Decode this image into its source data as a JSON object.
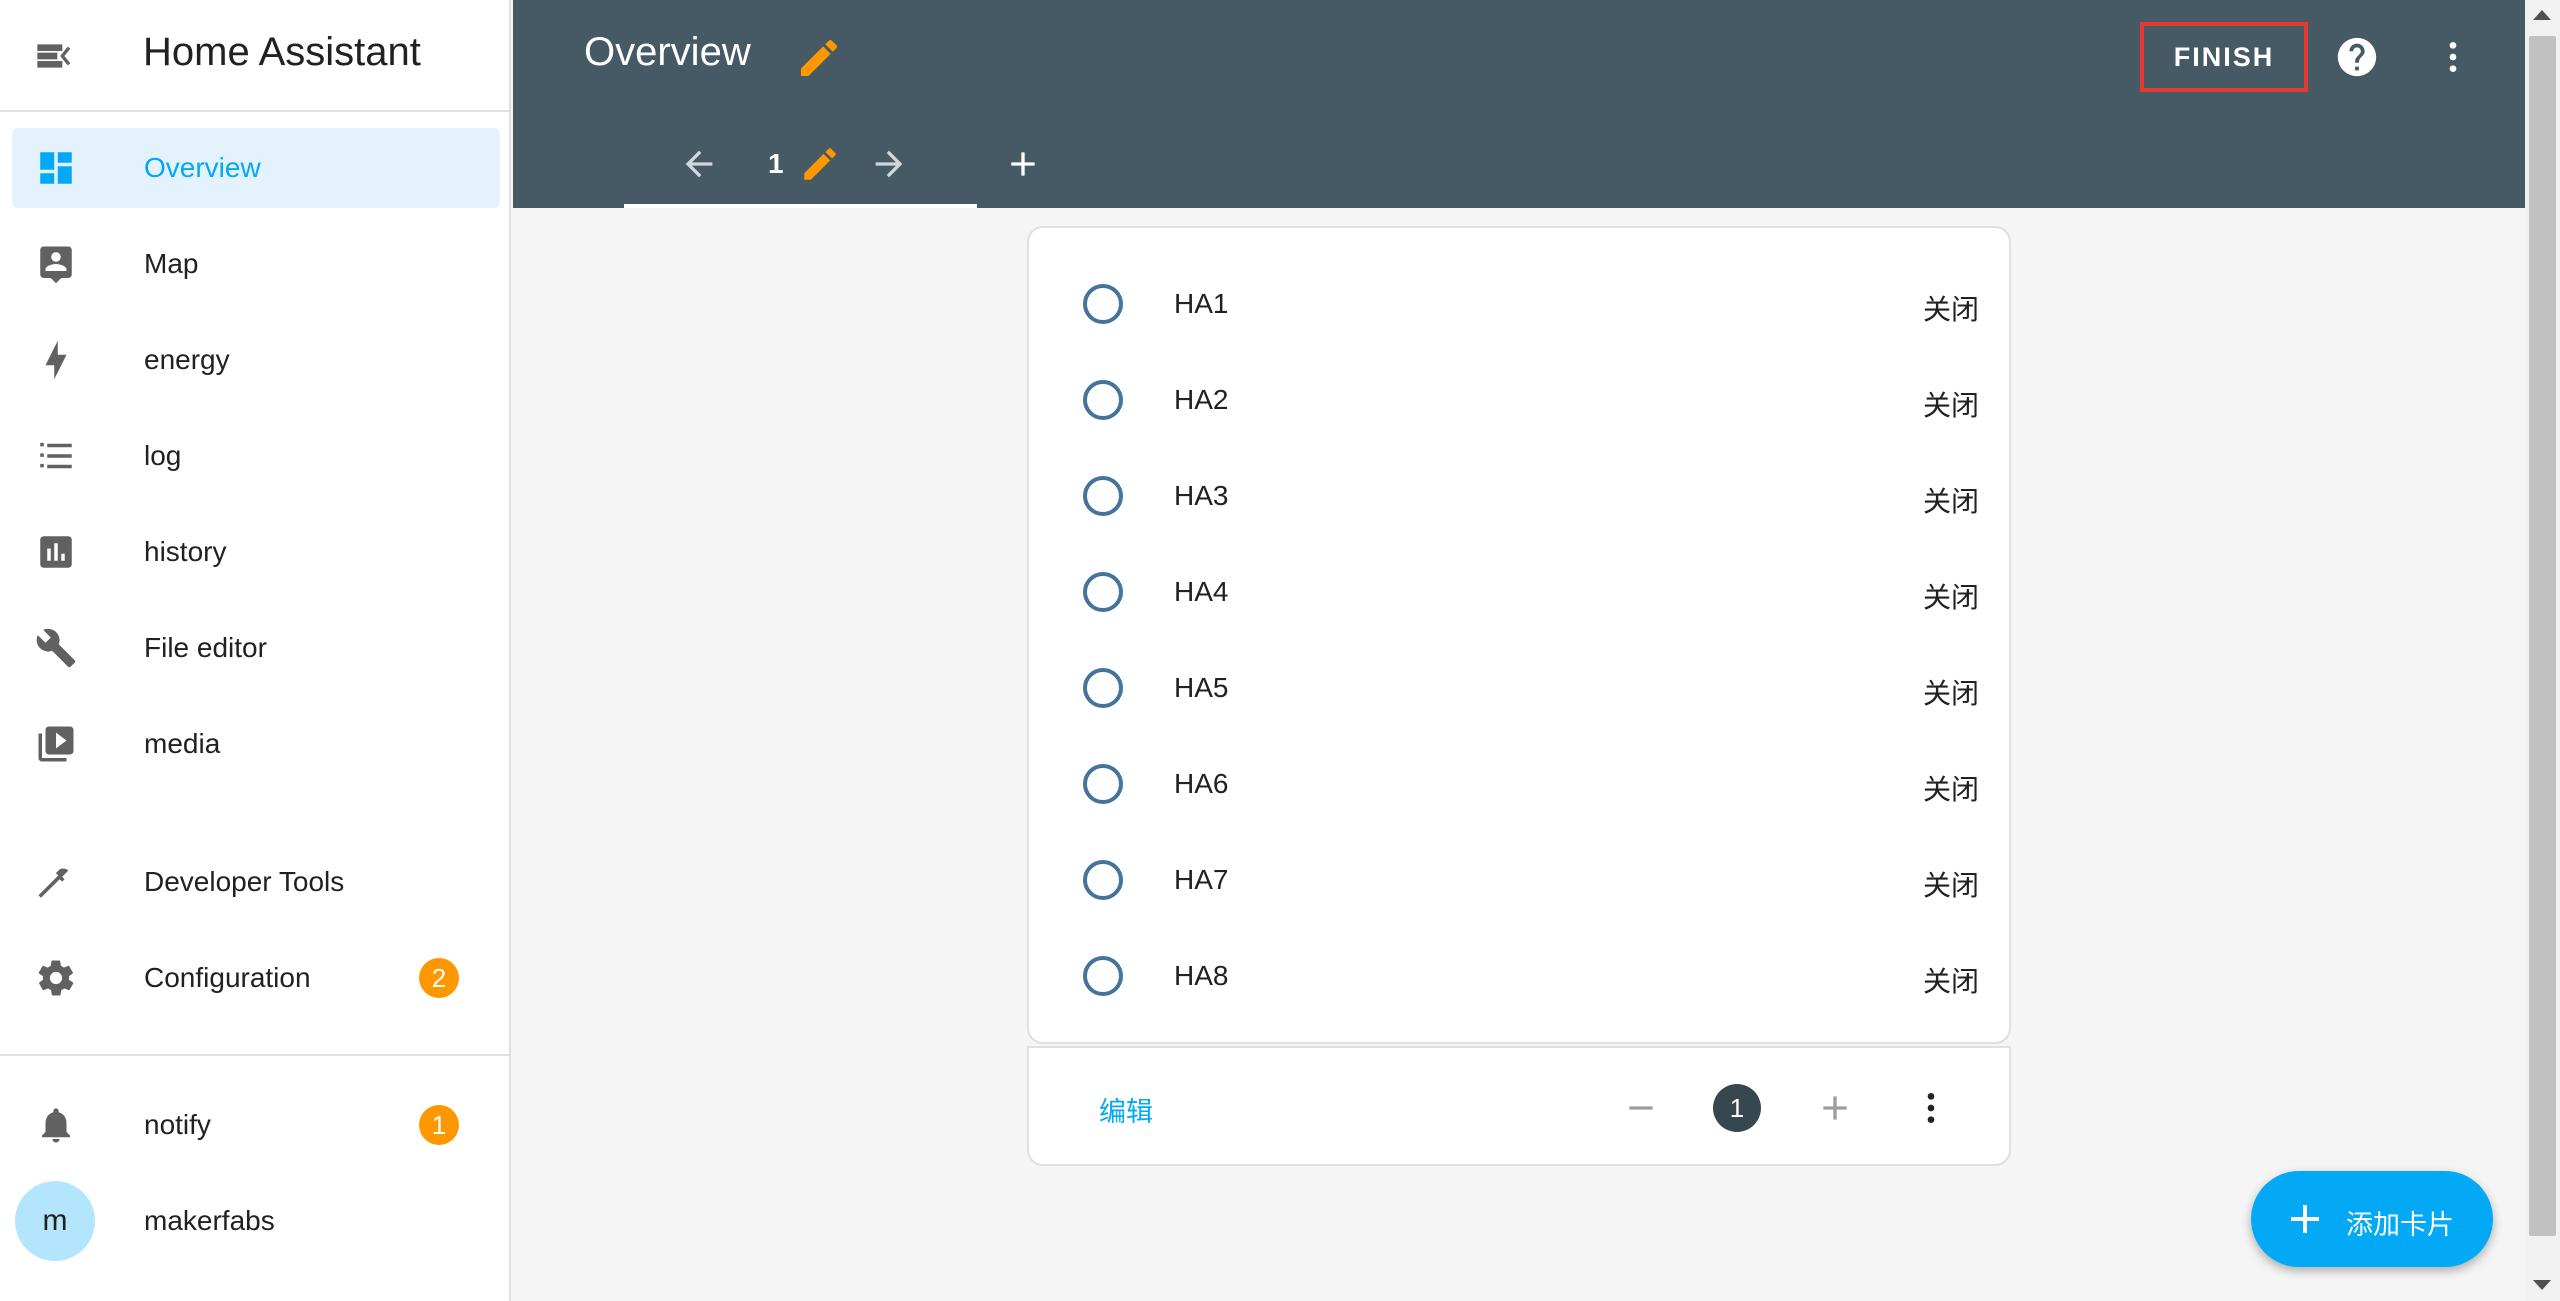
{
  "sidebar": {
    "title": "Home Assistant",
    "items": [
      {
        "label": "Overview",
        "icon": "dashboard-icon",
        "active": true
      },
      {
        "label": "Map",
        "icon": "account-box-icon"
      },
      {
        "label": "energy",
        "icon": "lightning-icon"
      },
      {
        "label": "log",
        "icon": "list-icon"
      },
      {
        "label": "history",
        "icon": "chart-box-icon"
      },
      {
        "label": "File editor",
        "icon": "wrench-icon"
      },
      {
        "label": "media",
        "icon": "play-box-icon"
      }
    ],
    "dev_tools_label": "Developer Tools",
    "config_label": "Configuration",
    "config_badge": "2",
    "notify_label": "notify",
    "notify_badge": "1",
    "user_initial": "m",
    "user_name": "makerfabs"
  },
  "toolbar": {
    "title": "Overview",
    "finish_label": "FINISH",
    "view_number": "1"
  },
  "card": {
    "entities": [
      {
        "name": "HA1",
        "state": "关闭"
      },
      {
        "name": "HA2",
        "state": "关闭"
      },
      {
        "name": "HA3",
        "state": "关闭"
      },
      {
        "name": "HA4",
        "state": "关闭"
      },
      {
        "name": "HA5",
        "state": "关闭"
      },
      {
        "name": "HA6",
        "state": "关闭"
      },
      {
        "name": "HA7",
        "state": "关闭"
      },
      {
        "name": "HA8",
        "state": "关闭"
      }
    ],
    "edit_label": "编辑",
    "position": "1"
  },
  "fab": {
    "label": "添加卡片"
  },
  "colors": {
    "accent": "#03a9f4",
    "toolbar": "#455a64",
    "edit_pencil": "#ff9800",
    "badge": "#ff9800",
    "radio": "#44739e",
    "highlight_border": "#e53935"
  }
}
